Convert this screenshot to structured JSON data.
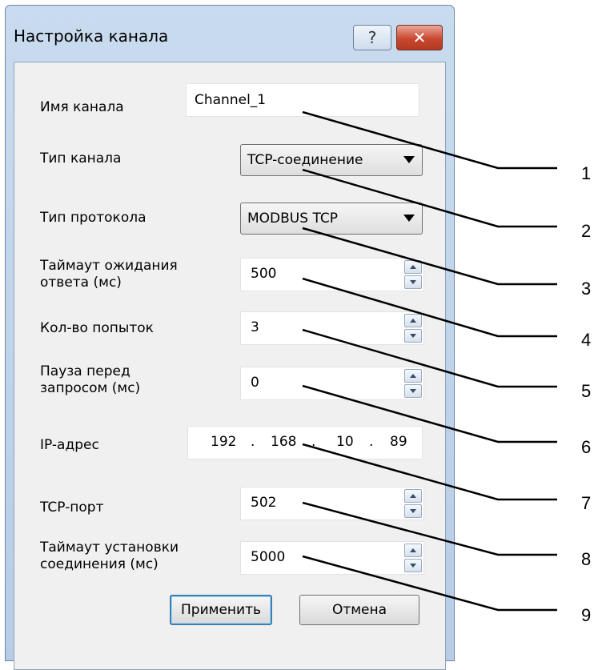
{
  "window": {
    "title": "Настройка канала",
    "help_label": "?",
    "close_label": "✕"
  },
  "fields": {
    "channel_name": {
      "label": "Имя канала",
      "value": "Channel_1"
    },
    "channel_type": {
      "label": "Тип канала",
      "value": "TCP-соединение"
    },
    "protocol_type": {
      "label": "Тип протокола",
      "value": "MODBUS TCP"
    },
    "response_timeout": {
      "label_line1": "Таймаут ожидания",
      "label_line2": "ответа (мс)",
      "value": "500"
    },
    "retries": {
      "label": "Кол-во попыток",
      "value": "3"
    },
    "request_pause": {
      "label_line1": "Пауза перед",
      "label_line2": "запросом (мс)",
      "value": "0"
    },
    "ip_address": {
      "label": "IP-адрес",
      "octets": [
        "192",
        "168",
        "10",
        "89"
      ],
      "dot": "."
    },
    "tcp_port": {
      "label": "TCP-порт",
      "value": "502"
    },
    "connect_timeout": {
      "label_line1": "Таймаут установки",
      "label_line2": "соединения (мс)",
      "value": "5000"
    }
  },
  "buttons": {
    "apply": "Применить",
    "cancel": "Отмена"
  },
  "callouts": [
    "1",
    "2",
    "3",
    "4",
    "5",
    "6",
    "7",
    "8",
    "9"
  ]
}
